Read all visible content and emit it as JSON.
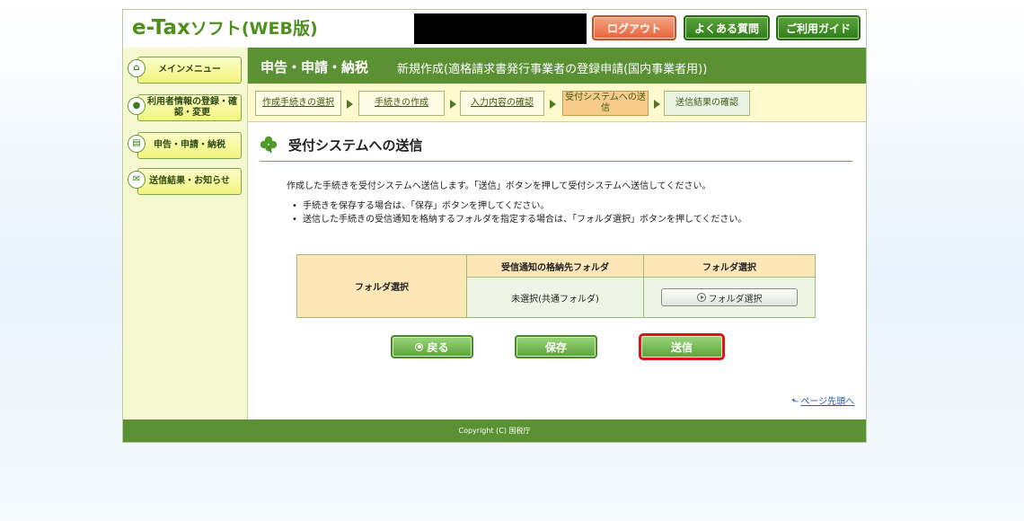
{
  "header": {
    "logo_main": "e-Tax",
    "logo_soft": "ソフト(WEB版)",
    "logout_label": "ログアウト",
    "faq_label": "よくある質問",
    "guide_label": "ご利用ガイド"
  },
  "sidebar": {
    "items": [
      {
        "label": "メインメニュー",
        "icon": "home-icon"
      },
      {
        "label": "利用者情報の登録・確認・変更",
        "icon": "user-info-icon"
      },
      {
        "label": "申告・申請・納税",
        "icon": "document-icon"
      },
      {
        "label": "送信結果・お知らせ",
        "icon": "mail-icon"
      }
    ]
  },
  "titlebar": {
    "section": "申告・申請・納税",
    "subtitle": "新規作成(適格請求書発行事業者の登録申請(国内事業者用))"
  },
  "steps": [
    {
      "label": "作成手続きの選択",
      "state": "done"
    },
    {
      "label": "手続きの作成",
      "state": "done"
    },
    {
      "label": "入力内容の確認",
      "state": "done"
    },
    {
      "label": "受付システムへの送信",
      "state": "current"
    },
    {
      "label": "送信結果の確認",
      "state": "pending"
    }
  ],
  "main": {
    "heading": "受付システムへの送信",
    "intro": "作成した手続きを受付システムへ送信します。「送信」ボタンを押して受付システムへ送信してください。",
    "notes": [
      "手続きを保存する場合は、「保存」ボタンを押してください。",
      "送信した手続きの受信通知を格納するフォルダを指定する場合は、「フォルダ選択」ボタンを押してください。"
    ],
    "table": {
      "row_label": "フォルダ選択",
      "col1_header": "受信通知の格納先フォルダ",
      "col2_header": "フォルダ選択",
      "folder_value": "未選択(共通フォルダ)",
      "folder_button": "フォルダ選択"
    },
    "back_label": "戻る",
    "save_label": "保存",
    "send_label": "送信",
    "page_top_label": "ページ先頭へ"
  },
  "footer": {
    "copyright": "Copyright (C) 国税庁"
  },
  "colors": {
    "brand_green": "#5a9132",
    "logout_orange": "#e8623a",
    "highlight_red": "#e0141a"
  }
}
